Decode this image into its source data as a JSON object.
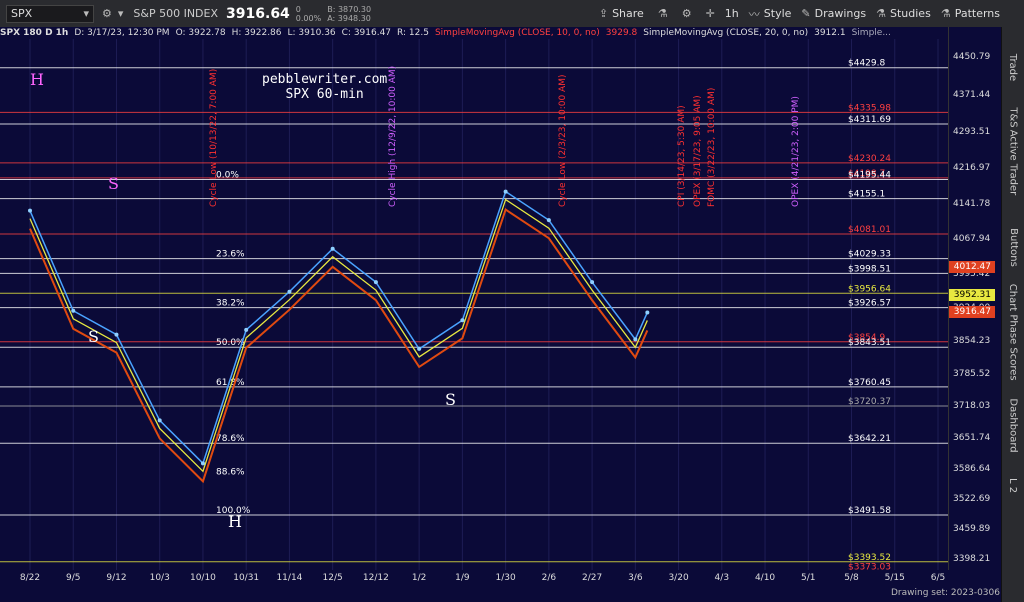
{
  "toolbar": {
    "symbol": "SPX",
    "index_name": "S&P 500 INDEX",
    "last_price": "3916.64",
    "change": "0",
    "change_pct": "0.00%",
    "bid": "B: 3870.30",
    "ask": "A: 3948.30",
    "share_label": "Share",
    "interval_label": "1h",
    "style_label": "Style",
    "drawings_label": "Drawings",
    "studies_label": "Studies",
    "patterns_label": "Patterns"
  },
  "chart_header": {
    "title": "SPX 180 D 1h",
    "date": "D: 3/17/23, 12:30 PM",
    "open": "O: 3922.78",
    "high": "H: 3922.86",
    "low": "L: 3910.36",
    "close": "C: 3916.47",
    "range": "R: 12.5",
    "sma1": "SimpleMovingAvg (CLOSE, 10, 0, no)",
    "sma1_val": "3929.8",
    "sma2": "SimpleMovingAvg (CLOSE, 20, 0, no)",
    "sma2_val": "3912.1",
    "more": "Simple..."
  },
  "watermark": {
    "line1": "pebblewriter.com",
    "line2": "SPX 60-min"
  },
  "right_tabs": [
    "Trade",
    "T&S",
    "Active Trader",
    "Buttons",
    "Chart",
    "Phase Scores",
    "Dashboard",
    "L 2"
  ],
  "footer": {
    "drawing_set": "Drawing set: 2023-0306"
  },
  "colors": {
    "background": "#0b0a38",
    "price_tag_red": "#e04020",
    "price_tag_yellow": "#e8e840",
    "sma10": "#e8e840",
    "sma20": "#e04a10"
  },
  "chart_data": {
    "type": "line",
    "title": "SPX 180 D 1h",
    "x_ticks": [
      "8/22",
      "9/5",
      "9/12",
      "10/3",
      "10/10",
      "10/31",
      "11/14",
      "12/5",
      "12/12",
      "1/2",
      "1/9",
      "1/30",
      "2/6",
      "2/27",
      "3/6",
      "3/20",
      "4/3",
      "4/10",
      "5/1",
      "5/8",
      "5/15",
      "6/5"
    ],
    "y_ticks": [
      4450.79,
      4371.44,
      4293.51,
      4216.97,
      4141.78,
      4067.94,
      3995.42,
      3924.0,
      3854.23,
      3785.52,
      3718.03,
      3651.74,
      3586.64,
      3522.69,
      3459.89,
      3398.21
    ],
    "ylim": [
      3370,
      4490
    ],
    "price_x": [
      "8/22",
      "9/5",
      "9/12",
      "10/3",
      "10/10",
      "10/31",
      "11/14",
      "12/5",
      "12/12",
      "1/2",
      "1/9",
      "1/30",
      "2/6",
      "2/27",
      "3/6",
      "3/17"
    ],
    "price_close": [
      4130,
      3920,
      3870,
      3690,
      3600,
      3880,
      3960,
      4050,
      3980,
      3840,
      3900,
      4170,
      4110,
      3980,
      3860,
      3916.47
    ],
    "horizontal_levels": [
      {
        "value": 4429.8,
        "label": "$4429.8",
        "color": "#ffffff"
      },
      {
        "value": 4335.98,
        "label": "$4335.98",
        "color": "#ff4040"
      },
      {
        "value": 4311.69,
        "label": "$4311.69",
        "color": "#ffffff"
      },
      {
        "value": 4230.24,
        "label": "$4230.24",
        "color": "#ff4040"
      },
      {
        "value": 4198.7,
        "label": "$4198.7",
        "color": "#ff4040"
      },
      {
        "value": 4195.44,
        "label": "$4195.44",
        "color": "#ffffff"
      },
      {
        "value": 4155.1,
        "label": "$4155.1",
        "color": "#ffffff"
      },
      {
        "value": 4081.01,
        "label": "$4081.01",
        "color": "#ff4040"
      },
      {
        "value": 4029.33,
        "label": "$4029.33",
        "color": "#ffffff"
      },
      {
        "value": 3998.51,
        "label": "$3998.51",
        "color": "#ffffff"
      },
      {
        "value": 3956.64,
        "label": "$3956.64",
        "color": "#e8e840"
      },
      {
        "value": 3926.57,
        "label": "$3926.57",
        "color": "#ffffff"
      },
      {
        "value": 3854.9,
        "label": "$3854.9",
        "color": "#ff4040"
      },
      {
        "value": 3843.51,
        "label": "$3843.51",
        "color": "#ffffff"
      },
      {
        "value": 3760.45,
        "label": "$3760.45",
        "color": "#ffffff"
      },
      {
        "value": 3720.37,
        "label": "$3720.37",
        "color": "#aaaaaa"
      },
      {
        "value": 3642.21,
        "label": "$3642.21",
        "color": "#ffffff"
      },
      {
        "value": 3491.58,
        "label": "$3491.58",
        "color": "#ffffff"
      },
      {
        "value": 3393.52,
        "label": "$3393.52",
        "color": "#e8e840"
      },
      {
        "value": 3373.03,
        "label": "$3373.03",
        "color": "#ff4040"
      }
    ],
    "fib_labels": [
      {
        "label": "0.0%",
        "value": 4195.44
      },
      {
        "label": "23.6%",
        "value": 4029.33
      },
      {
        "label": "38.2%",
        "value": 3926.57
      },
      {
        "label": "50.0%",
        "value": 3843.51
      },
      {
        "label": "61.8%",
        "value": 3760.45
      },
      {
        "label": "78.6%",
        "value": 3642.21
      },
      {
        "label": "88.6%",
        "value": 3572.0
      },
      {
        "label": "100.0%",
        "value": 3491.58
      }
    ],
    "price_tags": [
      {
        "value": 4012.47,
        "label": "4012.47",
        "color": "#e04020"
      },
      {
        "value": 3952.31,
        "label": "3952.31",
        "color": "#e8e840"
      },
      {
        "value": 3916.47,
        "label": "3916.47",
        "color": "#e04020"
      }
    ],
    "annotations": [
      "Cycle Low (10/13/22, 7:00 AM)",
      "Cycle High (12/9/22, 10:00 AM)",
      "Cycle Low (2/3/23, 10:00 AM)",
      "CPI (3/14/23, 5:30 AM)",
      "OPEX (3/17/23, 9:05 AM)",
      "FOMC (3/22/23, 10:00 AM)",
      "OPEX (4/21/23, 2:00 PM)"
    ],
    "pattern_labels": [
      "H",
      "S",
      "S",
      "S",
      "H"
    ]
  }
}
